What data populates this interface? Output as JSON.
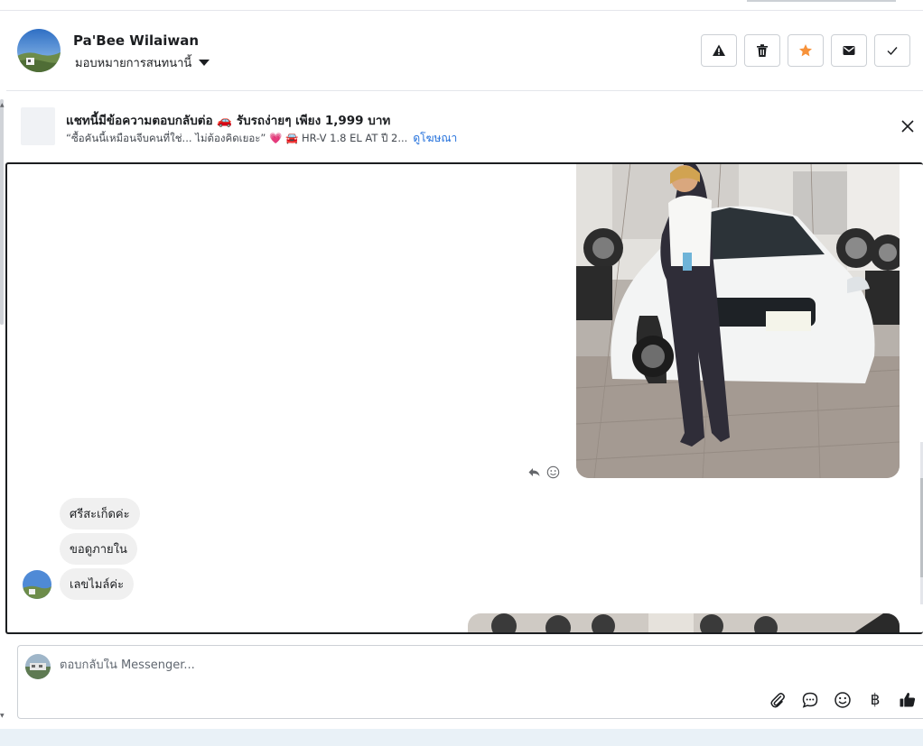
{
  "header": {
    "contact_name": "Pa'Bee Wilaiwan",
    "assign_label": "มอบหมายการสนทนานี้"
  },
  "actions": [
    {
      "name": "report-button",
      "icon": "warning-icon"
    },
    {
      "name": "delete-button",
      "icon": "trash-icon"
    },
    {
      "name": "star-button",
      "icon": "star-icon"
    },
    {
      "name": "mark-unread-button",
      "icon": "envelope-icon"
    },
    {
      "name": "mark-done-button",
      "icon": "check-icon"
    }
  ],
  "banner": {
    "title": "แชทนี้มีข้อความตอบกลับต่อ 🚗 รับรถง่ายๆ เพียง 1,999 บาท",
    "subtitle": "“ซื้อคันนี้เหมือนจีบคนที่ใช่... ไม่ต้องคิดเยอะ” 💗 🚘 HR-V 1.8 EL AT ปี 2...",
    "link": "ดูโฆษณา"
  },
  "messages": [
    {
      "text": "ศรีสะเก็ดค่ะ"
    },
    {
      "text": "ขอดูภายใน"
    },
    {
      "text": "เลขไมล์ค่ะ"
    }
  ],
  "composer": {
    "placeholder": "ตอบกลับใน Messenger...",
    "currency_symbol": "฿"
  },
  "colors": {
    "star_accent": "#f7923a",
    "link_blue": "#216fdb",
    "bubble_gray": "#f0f0f0",
    "bottom_band": "#e9f1f7"
  }
}
